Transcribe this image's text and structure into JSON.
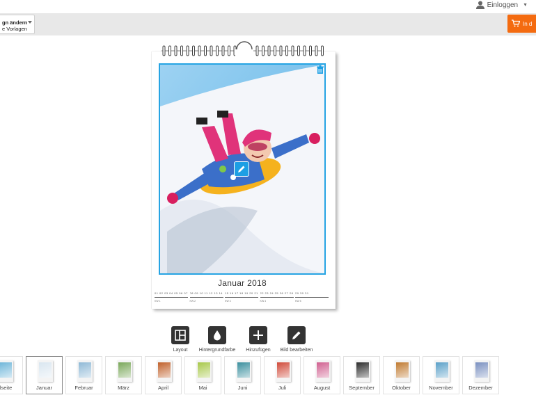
{
  "header": {
    "login_label": "Einloggen",
    "icons": {
      "user": "user-icon",
      "caret": "caret-down-icon"
    }
  },
  "toolbar": {
    "design_line1": "gn ändern",
    "design_line2": "e Vorlagen",
    "cart_label": "In d",
    "cart_color": "#f46b10"
  },
  "calendar": {
    "month_title": "Januar 2018",
    "frame_color": "#26a4e3",
    "weeks": [
      {
        "nums": "01 02 03 04 05 06 07",
        "lbl": "KW 1"
      },
      {
        "nums": "08 09 10 11 12 13 14",
        "lbl": "KW 2"
      },
      {
        "nums": "15 16 17 18 19 20 21",
        "lbl": "KW 3"
      },
      {
        "nums": "22 23 24 25 26 27 28",
        "lbl": "KW 4"
      },
      {
        "nums": "29 30 31",
        "lbl": "KW 5"
      }
    ]
  },
  "actions": [
    {
      "label": "Layout",
      "icon": "layout-icon"
    },
    {
      "label": "Hintergrundfarbe",
      "icon": "droplet-icon"
    },
    {
      "label": "Hinzufügen",
      "icon": "plus-icon"
    },
    {
      "label": "Bild bearbeiten",
      "icon": "pencil-icon"
    }
  ],
  "thumbnails": [
    {
      "label": "elseite",
      "color": "#6fb6d9"
    },
    {
      "label": "Januar",
      "color": "#d9e6f0",
      "active": true
    },
    {
      "label": "Februar",
      "color": "#8fb9d6"
    },
    {
      "label": "März",
      "color": "#7aa85a"
    },
    {
      "label": "April",
      "color": "#c0602a"
    },
    {
      "label": "Mai",
      "color": "#a8c84a"
    },
    {
      "label": "Juni",
      "color": "#3a8f9e"
    },
    {
      "label": "Juli",
      "color": "#d04a3a"
    },
    {
      "label": "August",
      "color": "#d06090"
    },
    {
      "label": "September",
      "color": "#2a2a2a"
    },
    {
      "label": "Oktober",
      "color": "#c07a30"
    },
    {
      "label": "November",
      "color": "#5aa0c8"
    },
    {
      "label": "Dezember",
      "color": "#7a90c0"
    }
  ]
}
